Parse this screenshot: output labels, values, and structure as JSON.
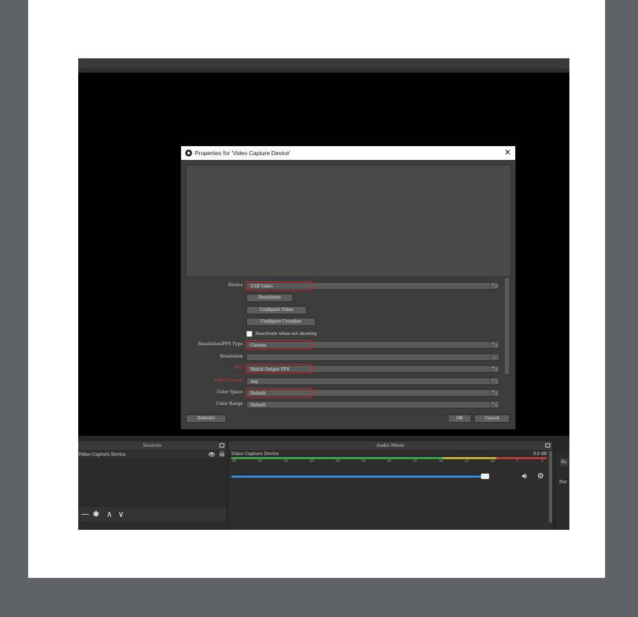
{
  "dialog": {
    "title": "Properties for 'Video Capture Device'",
    "close_glyph": "✕",
    "properties": [
      {
        "label": "Device",
        "value": "USB Video",
        "arrow": "⌃⌄",
        "highlight": true,
        "label_red": false
      },
      {
        "label": "Resolution/FPS Type",
        "value": "Custom",
        "arrow": "⌃⌄",
        "highlight": true,
        "label_red": false
      },
      {
        "label": "Resolution",
        "value": "",
        "arrow": "⌄",
        "highlight": false,
        "label_red": false
      },
      {
        "label": "FPS",
        "value": "Match Output FPS",
        "arrow": "⌃⌄",
        "highlight": true,
        "label_red": true
      },
      {
        "label": "Video Format",
        "value": "Any",
        "arrow": "⌃⌄",
        "highlight": false,
        "label_red": true
      },
      {
        "label": "Color Space",
        "value": "Default",
        "arrow": "⌃⌄",
        "highlight": true,
        "label_red": false
      },
      {
        "label": "Color Range",
        "value": "Default",
        "arrow": "⌃⌄",
        "highlight": false,
        "label_red": false
      }
    ],
    "buttons": {
      "deactivate": "Deactivate",
      "configure_video": "Configure Video",
      "configure_crossbar": "Configure Crossbar"
    },
    "checkbox_label": "Deactivate when not showing",
    "footer": {
      "defaults": "Defaults",
      "ok": "OK",
      "cancel": "Cancel"
    }
  },
  "sources": {
    "title": "Sources",
    "items": [
      "Video Capture Device"
    ],
    "toolbar": {
      "remove": "—",
      "settings": "✱",
      "up": "∧",
      "down": "∨"
    }
  },
  "mixer": {
    "title": "Audio Mixer",
    "channel_name": "Video Capture Device",
    "level": "0.0 dB",
    "ticks": [
      "-60",
      "-55",
      "-50",
      "-45",
      "-40",
      "-35",
      "-30",
      "-25",
      "-20",
      "-15",
      "-10",
      "-5",
      "0"
    ],
    "volume_fraction": 0.88
  },
  "controls": {
    "button_label": "Fa",
    "text": "Dur"
  }
}
